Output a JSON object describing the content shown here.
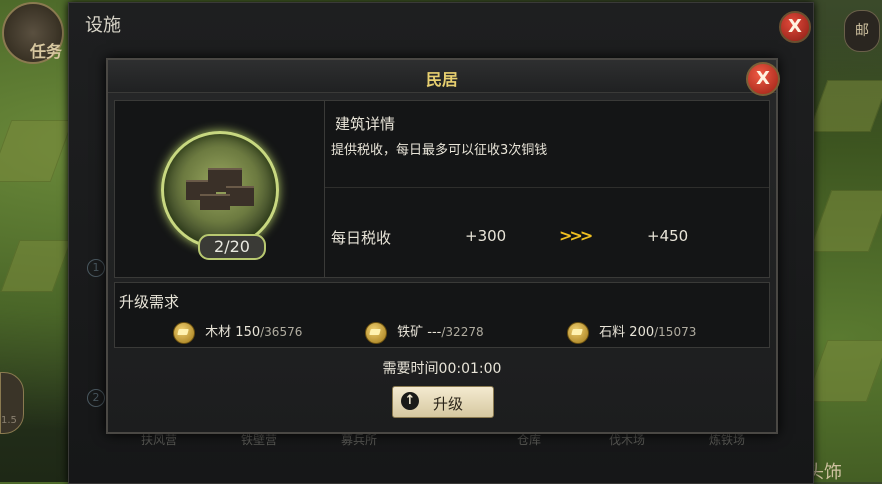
{
  "background": {
    "avatar_text": "任务",
    "right_button_text": "邮",
    "left_button_text": "1.5",
    "bottom_right_text": "头饰"
  },
  "outer_panel": {
    "title": "设施",
    "close_label": "X",
    "side_numbers": [
      "1",
      "2"
    ],
    "bottom_tabs": [
      "扶风营",
      "铁壁营",
      "募兵所",
      "仓库",
      "伐木场",
      "炼铁场"
    ]
  },
  "dialog": {
    "title": "民居",
    "close_label": "X",
    "building": {
      "level": "2/20"
    },
    "details": {
      "title": "建筑详情",
      "description": "提供税收，每日最多可以征收3次铜钱",
      "tax_label": "每日税收",
      "tax_current": "+300",
      "tax_arrows": ">>>",
      "tax_next": "+450"
    },
    "requirements": {
      "title": "升级需求",
      "items": [
        {
          "icon": "wood-icon",
          "name": "木材",
          "have": "150",
          "need": "/36576"
        },
        {
          "icon": "iron-icon",
          "name": "铁矿",
          "have": "---",
          "need": "/32278"
        },
        {
          "icon": "stone-icon",
          "name": "石料",
          "have": "200",
          "need": "/15073"
        }
      ]
    },
    "time_text": "需要时间00:01:00",
    "upgrade_label": "升级"
  },
  "colors": {
    "title_gold": "#e8d070",
    "arrow_yellow": "#f0c020",
    "close_red": "#d23a2a"
  }
}
